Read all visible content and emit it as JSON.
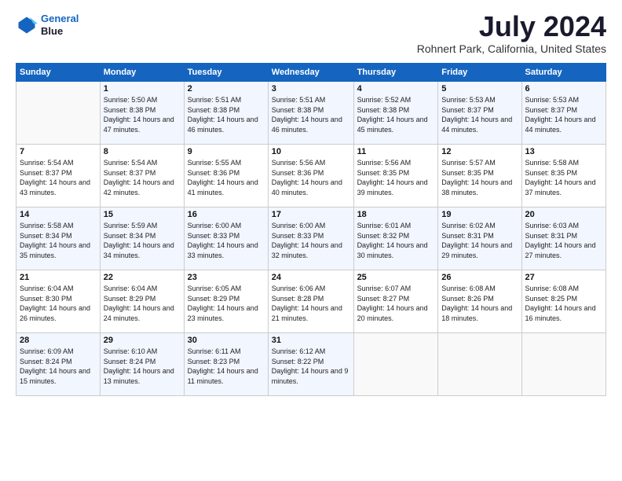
{
  "header": {
    "logo_line1": "General",
    "logo_line2": "Blue",
    "title": "July 2024",
    "location": "Rohnert Park, California, United States"
  },
  "days_of_week": [
    "Sunday",
    "Monday",
    "Tuesday",
    "Wednesday",
    "Thursday",
    "Friday",
    "Saturday"
  ],
  "weeks": [
    [
      {
        "day": "",
        "sunrise": "",
        "sunset": "",
        "daylight": ""
      },
      {
        "day": "1",
        "sunrise": "Sunrise: 5:50 AM",
        "sunset": "Sunset: 8:38 PM",
        "daylight": "Daylight: 14 hours and 47 minutes."
      },
      {
        "day": "2",
        "sunrise": "Sunrise: 5:51 AM",
        "sunset": "Sunset: 8:38 PM",
        "daylight": "Daylight: 14 hours and 46 minutes."
      },
      {
        "day": "3",
        "sunrise": "Sunrise: 5:51 AM",
        "sunset": "Sunset: 8:38 PM",
        "daylight": "Daylight: 14 hours and 46 minutes."
      },
      {
        "day": "4",
        "sunrise": "Sunrise: 5:52 AM",
        "sunset": "Sunset: 8:38 PM",
        "daylight": "Daylight: 14 hours and 45 minutes."
      },
      {
        "day": "5",
        "sunrise": "Sunrise: 5:53 AM",
        "sunset": "Sunset: 8:37 PM",
        "daylight": "Daylight: 14 hours and 44 minutes."
      },
      {
        "day": "6",
        "sunrise": "Sunrise: 5:53 AM",
        "sunset": "Sunset: 8:37 PM",
        "daylight": "Daylight: 14 hours and 44 minutes."
      }
    ],
    [
      {
        "day": "7",
        "sunrise": "Sunrise: 5:54 AM",
        "sunset": "Sunset: 8:37 PM",
        "daylight": "Daylight: 14 hours and 43 minutes."
      },
      {
        "day": "8",
        "sunrise": "Sunrise: 5:54 AM",
        "sunset": "Sunset: 8:37 PM",
        "daylight": "Daylight: 14 hours and 42 minutes."
      },
      {
        "day": "9",
        "sunrise": "Sunrise: 5:55 AM",
        "sunset": "Sunset: 8:36 PM",
        "daylight": "Daylight: 14 hours and 41 minutes."
      },
      {
        "day": "10",
        "sunrise": "Sunrise: 5:56 AM",
        "sunset": "Sunset: 8:36 PM",
        "daylight": "Daylight: 14 hours and 40 minutes."
      },
      {
        "day": "11",
        "sunrise": "Sunrise: 5:56 AM",
        "sunset": "Sunset: 8:35 PM",
        "daylight": "Daylight: 14 hours and 39 minutes."
      },
      {
        "day": "12",
        "sunrise": "Sunrise: 5:57 AM",
        "sunset": "Sunset: 8:35 PM",
        "daylight": "Daylight: 14 hours and 38 minutes."
      },
      {
        "day": "13",
        "sunrise": "Sunrise: 5:58 AM",
        "sunset": "Sunset: 8:35 PM",
        "daylight": "Daylight: 14 hours and 37 minutes."
      }
    ],
    [
      {
        "day": "14",
        "sunrise": "Sunrise: 5:58 AM",
        "sunset": "Sunset: 8:34 PM",
        "daylight": "Daylight: 14 hours and 35 minutes."
      },
      {
        "day": "15",
        "sunrise": "Sunrise: 5:59 AM",
        "sunset": "Sunset: 8:34 PM",
        "daylight": "Daylight: 14 hours and 34 minutes."
      },
      {
        "day": "16",
        "sunrise": "Sunrise: 6:00 AM",
        "sunset": "Sunset: 8:33 PM",
        "daylight": "Daylight: 14 hours and 33 minutes."
      },
      {
        "day": "17",
        "sunrise": "Sunrise: 6:00 AM",
        "sunset": "Sunset: 8:33 PM",
        "daylight": "Daylight: 14 hours and 32 minutes."
      },
      {
        "day": "18",
        "sunrise": "Sunrise: 6:01 AM",
        "sunset": "Sunset: 8:32 PM",
        "daylight": "Daylight: 14 hours and 30 minutes."
      },
      {
        "day": "19",
        "sunrise": "Sunrise: 6:02 AM",
        "sunset": "Sunset: 8:31 PM",
        "daylight": "Daylight: 14 hours and 29 minutes."
      },
      {
        "day": "20",
        "sunrise": "Sunrise: 6:03 AM",
        "sunset": "Sunset: 8:31 PM",
        "daylight": "Daylight: 14 hours and 27 minutes."
      }
    ],
    [
      {
        "day": "21",
        "sunrise": "Sunrise: 6:04 AM",
        "sunset": "Sunset: 8:30 PM",
        "daylight": "Daylight: 14 hours and 26 minutes."
      },
      {
        "day": "22",
        "sunrise": "Sunrise: 6:04 AM",
        "sunset": "Sunset: 8:29 PM",
        "daylight": "Daylight: 14 hours and 24 minutes."
      },
      {
        "day": "23",
        "sunrise": "Sunrise: 6:05 AM",
        "sunset": "Sunset: 8:29 PM",
        "daylight": "Daylight: 14 hours and 23 minutes."
      },
      {
        "day": "24",
        "sunrise": "Sunrise: 6:06 AM",
        "sunset": "Sunset: 8:28 PM",
        "daylight": "Daylight: 14 hours and 21 minutes."
      },
      {
        "day": "25",
        "sunrise": "Sunrise: 6:07 AM",
        "sunset": "Sunset: 8:27 PM",
        "daylight": "Daylight: 14 hours and 20 minutes."
      },
      {
        "day": "26",
        "sunrise": "Sunrise: 6:08 AM",
        "sunset": "Sunset: 8:26 PM",
        "daylight": "Daylight: 14 hours and 18 minutes."
      },
      {
        "day": "27",
        "sunrise": "Sunrise: 6:08 AM",
        "sunset": "Sunset: 8:25 PM",
        "daylight": "Daylight: 14 hours and 16 minutes."
      }
    ],
    [
      {
        "day": "28",
        "sunrise": "Sunrise: 6:09 AM",
        "sunset": "Sunset: 8:24 PM",
        "daylight": "Daylight: 14 hours and 15 minutes."
      },
      {
        "day": "29",
        "sunrise": "Sunrise: 6:10 AM",
        "sunset": "Sunset: 8:24 PM",
        "daylight": "Daylight: 14 hours and 13 minutes."
      },
      {
        "day": "30",
        "sunrise": "Sunrise: 6:11 AM",
        "sunset": "Sunset: 8:23 PM",
        "daylight": "Daylight: 14 hours and 11 minutes."
      },
      {
        "day": "31",
        "sunrise": "Sunrise: 6:12 AM",
        "sunset": "Sunset: 8:22 PM",
        "daylight": "Daylight: 14 hours and 9 minutes."
      },
      {
        "day": "",
        "sunrise": "",
        "sunset": "",
        "daylight": ""
      },
      {
        "day": "",
        "sunrise": "",
        "sunset": "",
        "daylight": ""
      },
      {
        "day": "",
        "sunrise": "",
        "sunset": "",
        "daylight": ""
      }
    ]
  ]
}
